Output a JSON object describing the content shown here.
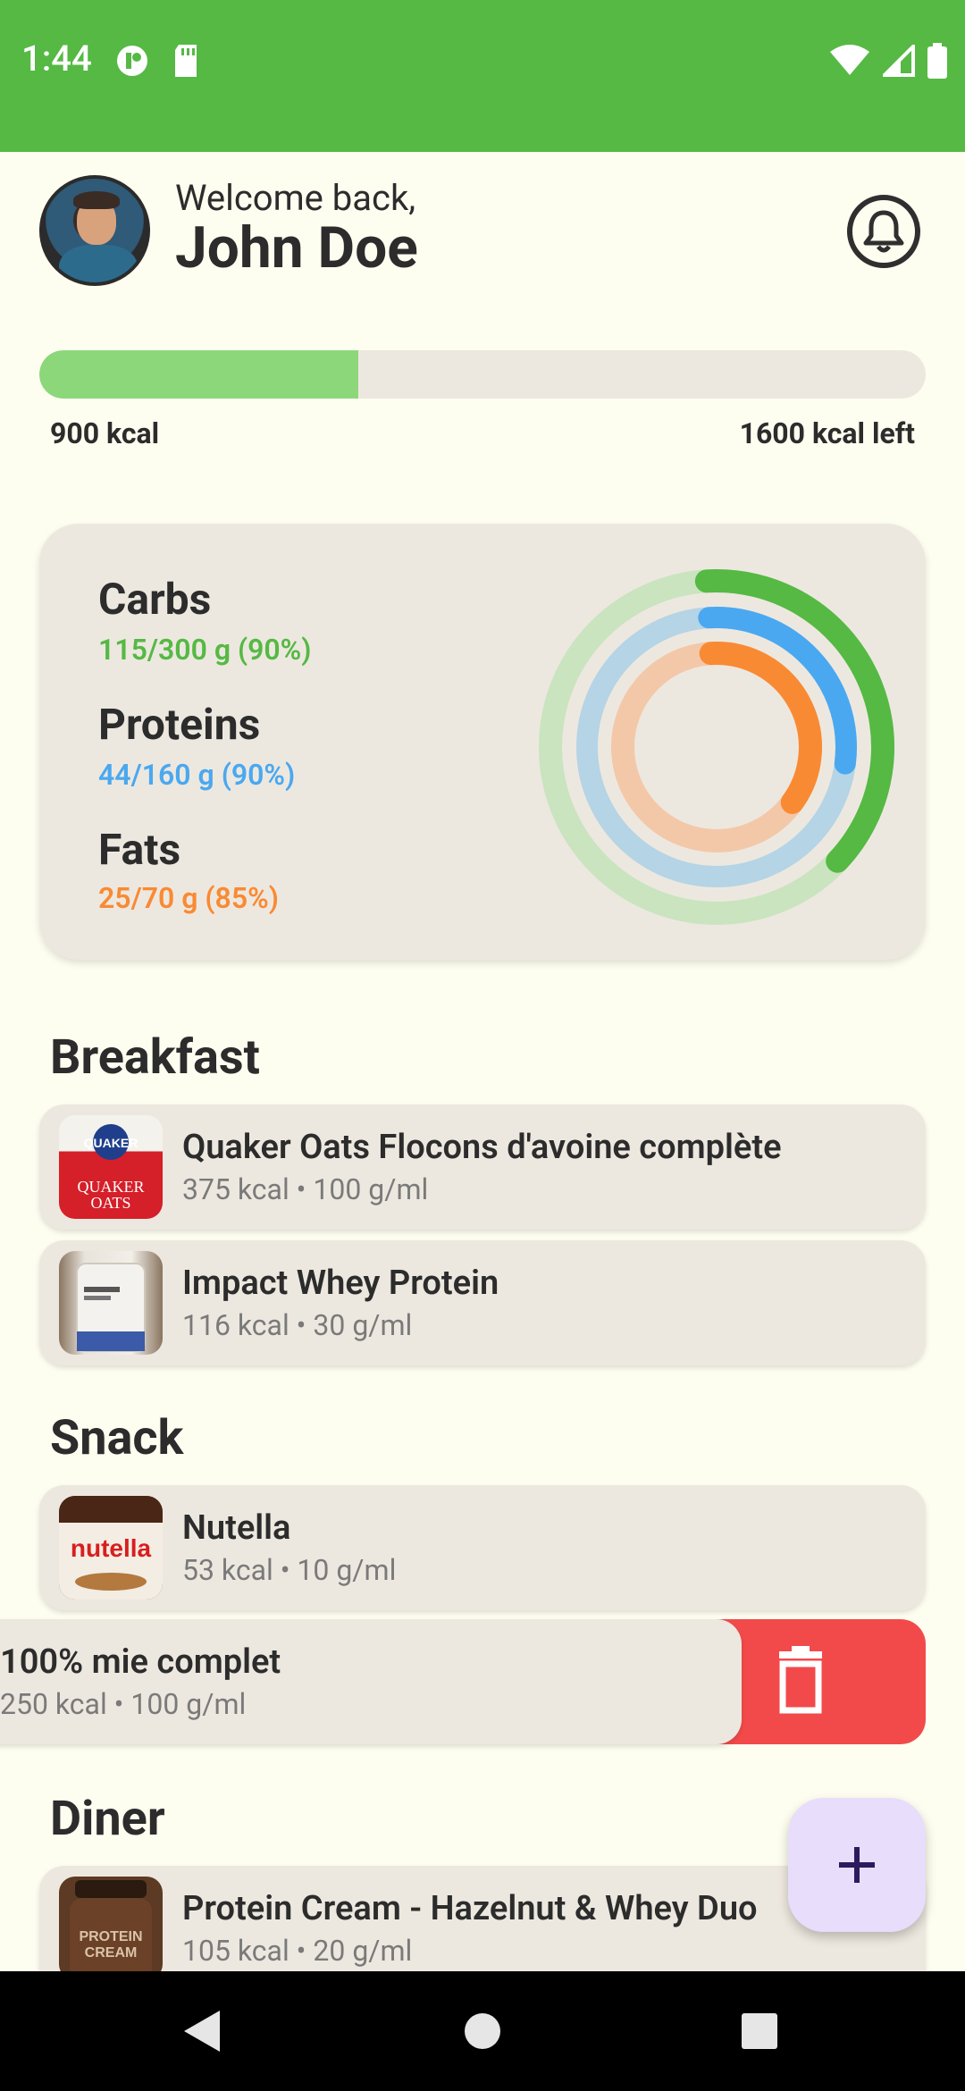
{
  "status_bar": {
    "time": "1:44",
    "background": "#55b944"
  },
  "header": {
    "welcome_text": "Welcome back,",
    "user_name": "John Doe",
    "avatar_icon": "profile-photo",
    "notification_icon": "bell-icon"
  },
  "calories": {
    "consumed_label": "900 kcal",
    "left_label": "1600 kcal left",
    "progress_fraction": 0.36,
    "fill_color": "#8cd77a"
  },
  "macros": {
    "carbs": {
      "label": "Carbs",
      "value": "115/300 g (90%)",
      "color": "#55b944",
      "ring_fraction": 0.38
    },
    "proteins": {
      "label": "Proteins",
      "value": "44/160 g (90%)",
      "color": "#4aa8f0",
      "ring_fraction": 0.28
    },
    "fats": {
      "label": "Fats",
      "value": "25/70 g (85%)",
      "color": "#f98a34",
      "ring_fraction": 0.36
    }
  },
  "meals": {
    "breakfast": {
      "title": "Breakfast",
      "items": [
        {
          "name": "Quaker Oats Flocons d'avoine complète",
          "meta": "375 kcal • 100 g/ml"
        },
        {
          "name": "Impact Whey Protein",
          "meta": "116 kcal • 30 g/ml"
        }
      ]
    },
    "snack": {
      "title": "Snack",
      "items": [
        {
          "name": "Nutella",
          "meta": "53 kcal • 10 g/ml"
        },
        {
          "name": "100% mie complet",
          "meta": "250 kcal • 100 g/ml"
        }
      ]
    },
    "diner": {
      "title": "Diner",
      "items": [
        {
          "name": "Protein Cream - Hazelnut & Whey Duo",
          "meta": "105 kcal • 20 g/ml"
        }
      ]
    }
  },
  "actions": {
    "delete_icon": "trash-icon",
    "add_icon": "plus-icon"
  },
  "colors": {
    "delete": "#f24a4a",
    "fab": "#e8ddfa",
    "background": "#fdfdf0",
    "card": "#ede8df"
  }
}
